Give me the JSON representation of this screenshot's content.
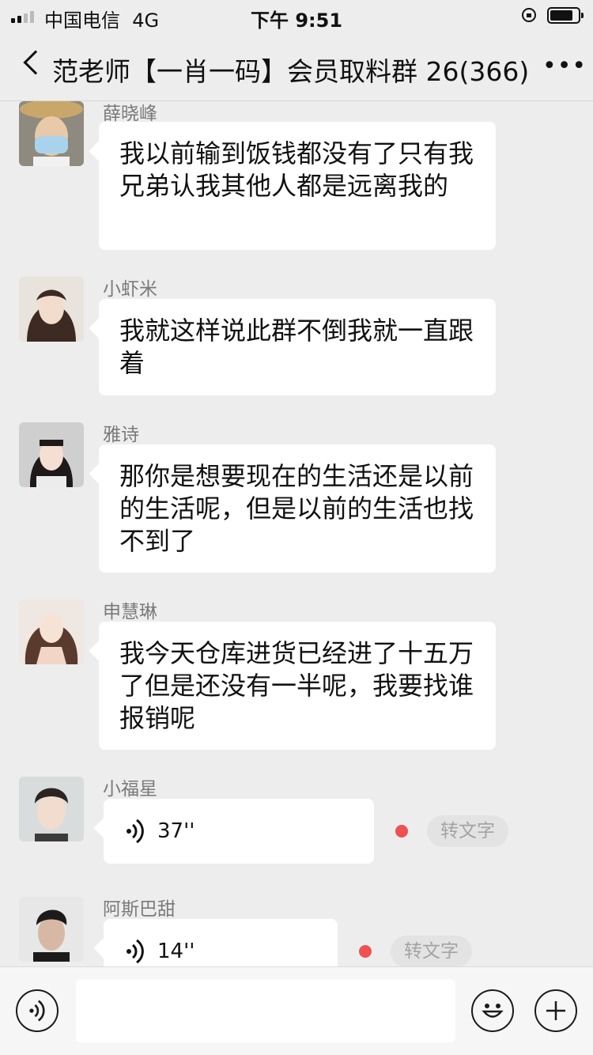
{
  "status_bar": {
    "carrier": "中国电信",
    "network": "4G",
    "time": "下午 9:51"
  },
  "header": {
    "title": "范老师【一肖一码】会员取料群 26(366)",
    "more": "•••"
  },
  "messages": [
    {
      "sender": "薛晓峰",
      "text": "我以前输到饭钱都没有了只有我兄弟认我其他人都是远离我的"
    },
    {
      "sender": "小虾米",
      "text": "我就这样说此群不倒我就一直跟着"
    },
    {
      "sender": "雅诗",
      "text": "那你是想要现在的生活还是以前的生活呢，但是以前的生活也找不到了"
    },
    {
      "sender": "申慧琳",
      "text": "我今天仓库进货已经进了十五万了但是还没有一半呢，我要找谁报销呢"
    },
    {
      "sender": "小福星",
      "duration": "37''",
      "transcribe_label": "转文字"
    },
    {
      "sender": "阿斯巴甜",
      "duration": "14''",
      "transcribe_label": "转文字"
    }
  ],
  "colors": {
    "unread_dot": "#ee5151",
    "background": "#ededed",
    "bubble": "#ffffff"
  }
}
